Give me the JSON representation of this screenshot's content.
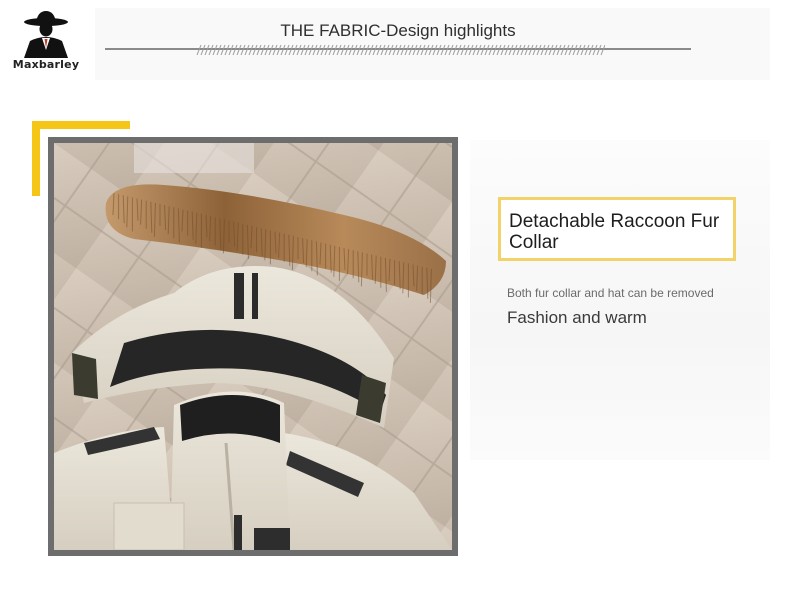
{
  "brand": {
    "name": "Maxbarley",
    "logo_icon": "hat-figure-icon"
  },
  "header": {
    "title": "THE FABRIC-Design highlights"
  },
  "feature": {
    "title": "Detachable Raccoon Fur Collar",
    "note": "Both fur collar and hat can be removed",
    "tagline": "Fashion and warm"
  },
  "colors": {
    "accent_yellow": "#f5c518",
    "box_border": "#f2d36a",
    "frame_gray": "#6d6d6d",
    "jacket_cream": "#e6e0d3",
    "fur_brown": "#a07447"
  }
}
